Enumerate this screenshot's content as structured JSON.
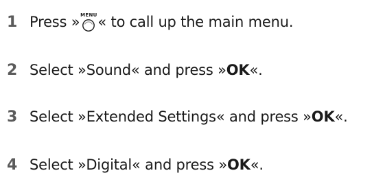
{
  "steps": [
    {
      "number": "1",
      "before_icon": "Press »",
      "icon": "circle-button-icon",
      "icon_label": "MENU",
      "after_icon": "« to call up the main menu."
    },
    {
      "number": "2",
      "text": "Select »Sound« and press »",
      "key": "OK",
      "end": "«."
    },
    {
      "number": "3",
      "text": "Select »Extended Settings« and press »",
      "key": "OK",
      "end": "«."
    },
    {
      "number": "4",
      "text": "Select »Digital« and press »",
      "key": "OK",
      "end": "«."
    }
  ]
}
